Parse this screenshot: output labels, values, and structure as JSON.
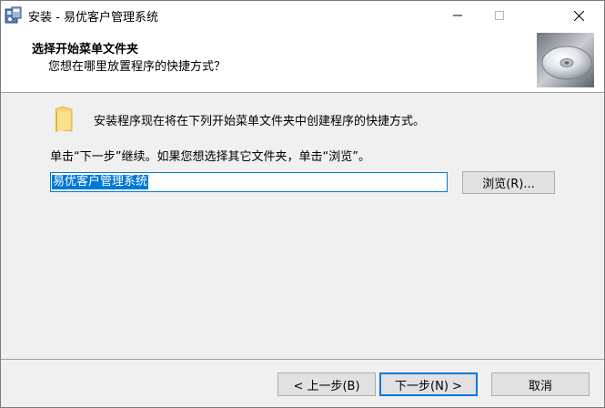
{
  "window": {
    "title": "安装 - 易优客户管理系统"
  },
  "header": {
    "title": "选择开始菜单文件夹",
    "subtitle": "您想在哪里放置程序的快捷方式？"
  },
  "content": {
    "intro_text": "安装程序现在将在下列开始菜单文件夹中创建程序的快捷方式。",
    "instruction_text": "单击“下一步”继续。如果您想选择其它文件夹，单击“浏览”。",
    "folder_value": "易优客户管理系统",
    "browse_label": "浏览(R)..."
  },
  "buttons": {
    "back_label": "< 上一步(B)",
    "next_label": "下一步(N) >",
    "cancel_label": "取消"
  },
  "colors": {
    "accent": "#0078d7",
    "header_bg": "#ffffff",
    "body_bg": "#f0f0f0"
  }
}
